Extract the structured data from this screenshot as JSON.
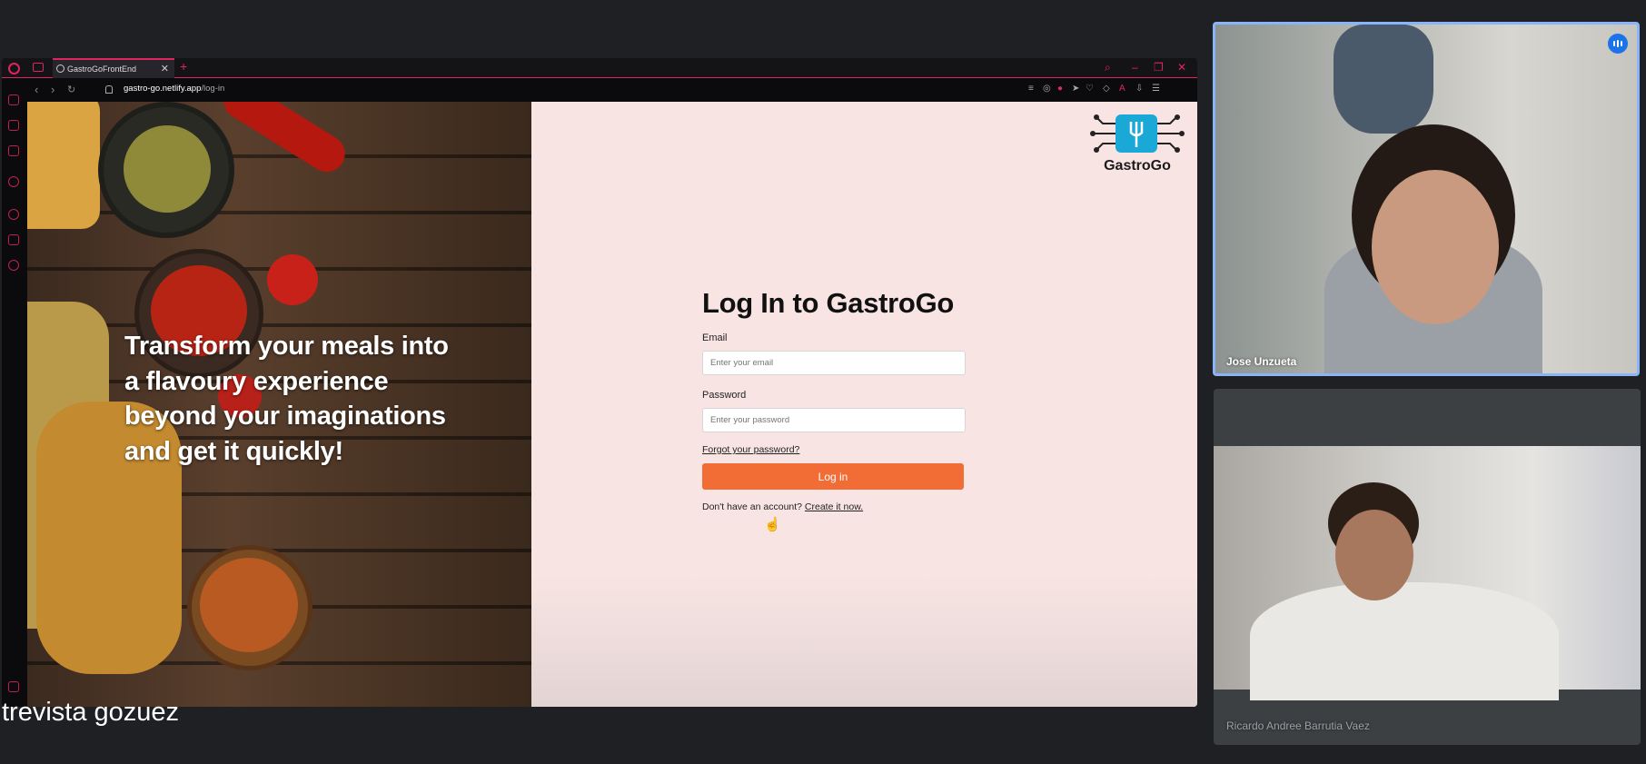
{
  "browser": {
    "tab_title": "GastroGoFrontEnd",
    "url_domain": "gastro-go.netlify.app",
    "url_path": "/log-in"
  },
  "hero": {
    "tagline": "Transform your meals into a flavoury experience beyond your imaginations and get it quickly!"
  },
  "logo": {
    "name": "GastroGo"
  },
  "login": {
    "title": "Log In to GastroGo",
    "email_label": "Email",
    "email_placeholder": "Enter your email",
    "password_label": "Password",
    "password_placeholder": "Enter your password",
    "forgot_link": "Forgot your password?",
    "submit_label": "Log in",
    "signup_prompt": "Don't have an account?",
    "signup_link": "Create it now."
  },
  "participants": [
    {
      "name": "Jose Unzueta",
      "speaking": true
    },
    {
      "name": "Ricardo Andree Barrutia Vaez",
      "speaking": false
    }
  ],
  "caption": "trevista gozuez",
  "colors": {
    "accent_button": "#f26c35",
    "panel_bg": "#f8e5e3",
    "browser_accent": "#e0245e",
    "active_speaker_border": "#8ab4f8"
  }
}
